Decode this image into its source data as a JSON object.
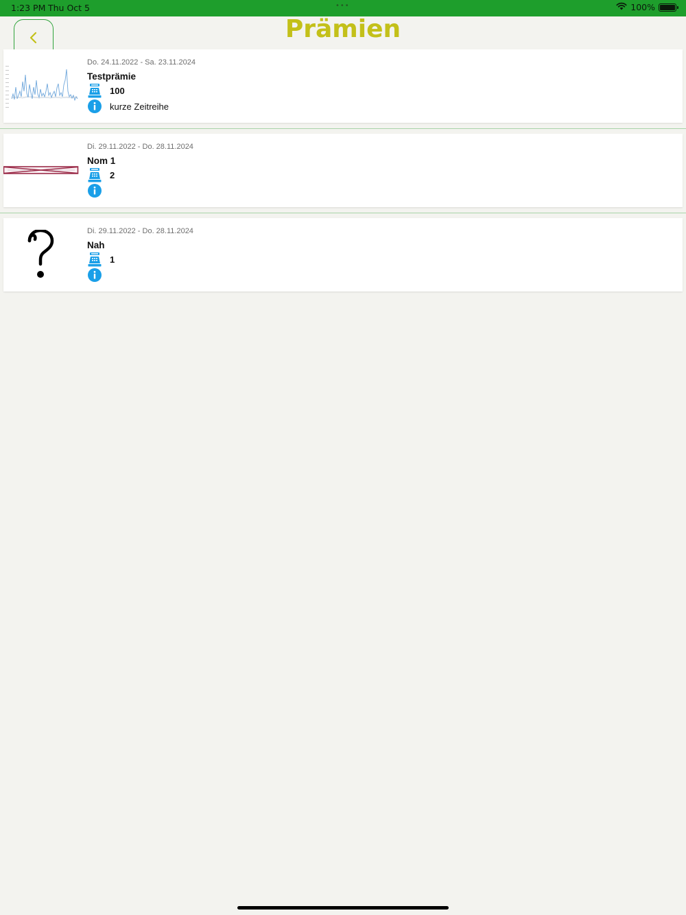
{
  "status_bar": {
    "time": "1:23 PM",
    "date": "Thu Oct 5",
    "dots": "•••",
    "battery_text": "100%",
    "battery_level": 1.0,
    "icons": [
      "wifi-icon",
      "battery-icon"
    ]
  },
  "header": {
    "title": "Prämien",
    "back_icon": "chevron-left-icon"
  },
  "colors": {
    "status_bar": "#1e9e2c",
    "title": "#c3c019",
    "back_border": "#2ea33a",
    "info_blue": "#1a9fe8",
    "background": "#f3f3ef"
  },
  "rewards": [
    {
      "thumbnail": "timeseries-chart-thumbnail",
      "date_range": "Do. 24.11.2022 - Sa. 23.11.2024",
      "name": "Testprämie",
      "count": "100",
      "info": "kurze Zeitreihe"
    },
    {
      "thumbnail": "crossed-out-image-thumbnail",
      "date_range": "Di. 29.11.2022 - Do. 28.11.2024",
      "name": "Nom 1",
      "count": "2",
      "info": ""
    },
    {
      "thumbnail": "question-mark-thumbnail",
      "date_range": "Di. 29.11.2022 - Do. 28.11.2024",
      "name": "Nah",
      "count": "1",
      "info": ""
    }
  ]
}
